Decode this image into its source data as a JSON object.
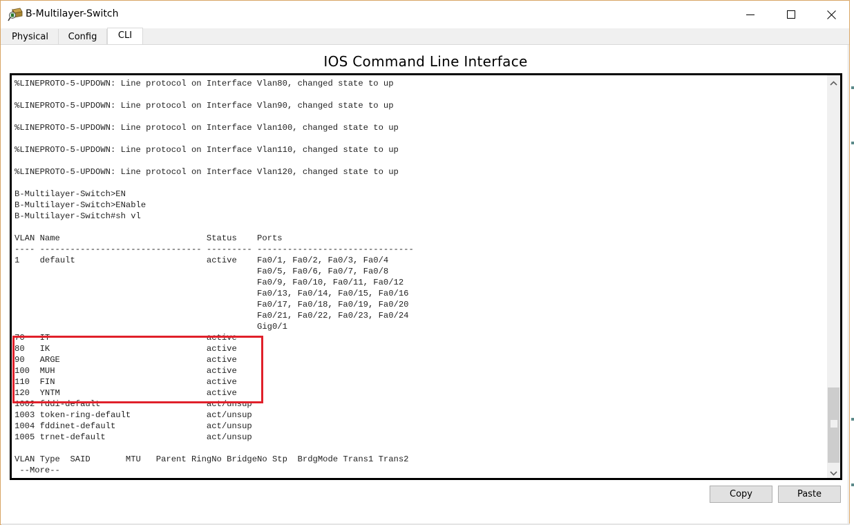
{
  "window": {
    "title": "B-Multilayer-Switch",
    "icon": "packet-tracer-device-icon",
    "controls": {
      "minimize": "minimize-icon",
      "maximize": "maximize-icon",
      "close": "close-icon"
    }
  },
  "tabs": [
    {
      "label": "Physical",
      "active": false
    },
    {
      "label": "Config",
      "active": false
    },
    {
      "label": "CLI",
      "active": true
    }
  ],
  "heading": "IOS Command Line Interface",
  "terminal": {
    "lines": [
      "%LINEPROTO-5-UPDOWN: Line protocol on Interface Vlan80, changed state to up",
      "",
      "%LINEPROTO-5-UPDOWN: Line protocol on Interface Vlan90, changed state to up",
      "",
      "%LINEPROTO-5-UPDOWN: Line protocol on Interface Vlan100, changed state to up",
      "",
      "%LINEPROTO-5-UPDOWN: Line protocol on Interface Vlan110, changed state to up",
      "",
      "%LINEPROTO-5-UPDOWN: Line protocol on Interface Vlan120, changed state to up",
      "",
      "B-Multilayer-Switch>EN",
      "B-Multilayer-Switch>ENable",
      "B-Multilayer-Switch#sh vl",
      "",
      "VLAN Name                             Status    Ports",
      "---- -------------------------------- --------- -------------------------------",
      "1    default                          active    Fa0/1, Fa0/2, Fa0/3, Fa0/4",
      "                                                Fa0/5, Fa0/6, Fa0/7, Fa0/8",
      "                                                Fa0/9, Fa0/10, Fa0/11, Fa0/12",
      "                                                Fa0/13, Fa0/14, Fa0/15, Fa0/16",
      "                                                Fa0/17, Fa0/18, Fa0/19, Fa0/20",
      "                                                Fa0/21, Fa0/22, Fa0/23, Fa0/24",
      "                                                Gig0/1",
      "70   IT                               active    ",
      "80   IK                               active    ",
      "90   ARGE                             active    ",
      "100  MUH                              active    ",
      "110  FIN                              active    ",
      "120  YNTM                             active    ",
      "1002 fddi-default                     act/unsup ",
      "1003 token-ring-default               act/unsup ",
      "1004 fddinet-default                  act/unsup ",
      "1005 trnet-default                    act/unsup ",
      "",
      "VLAN Type  SAID       MTU   Parent RingNo BridgeNo Stp  BrdgMode Trans1 Trans2",
      " --More--"
    ],
    "vlan_table": {
      "headers": [
        "VLAN",
        "Name",
        "Status",
        "Ports"
      ],
      "rows": [
        {
          "vlan": "1",
          "name": "default",
          "status": "active",
          "ports": "Fa0/1, Fa0/2, Fa0/3, Fa0/4, Fa0/5, Fa0/6, Fa0/7, Fa0/8, Fa0/9, Fa0/10, Fa0/11, Fa0/12, Fa0/13, Fa0/14, Fa0/15, Fa0/16, Fa0/17, Fa0/18, Fa0/19, Fa0/20, Fa0/21, Fa0/22, Fa0/23, Fa0/24, Gig0/1"
        },
        {
          "vlan": "70",
          "name": "IT",
          "status": "active",
          "ports": ""
        },
        {
          "vlan": "80",
          "name": "IK",
          "status": "active",
          "ports": ""
        },
        {
          "vlan": "90",
          "name": "ARGE",
          "status": "active",
          "ports": ""
        },
        {
          "vlan": "100",
          "name": "MUH",
          "status": "active",
          "ports": ""
        },
        {
          "vlan": "110",
          "name": "FIN",
          "status": "active",
          "ports": ""
        },
        {
          "vlan": "120",
          "name": "YNTM",
          "status": "active",
          "ports": ""
        },
        {
          "vlan": "1002",
          "name": "fddi-default",
          "status": "act/unsup",
          "ports": ""
        },
        {
          "vlan": "1003",
          "name": "token-ring-default",
          "status": "act/unsup",
          "ports": ""
        },
        {
          "vlan": "1004",
          "name": "fddinet-default",
          "status": "act/unsup",
          "ports": ""
        },
        {
          "vlan": "1005",
          "name": "trnet-default",
          "status": "act/unsup",
          "ports": ""
        }
      ],
      "highlighted_vlans": [
        "70",
        "80",
        "90",
        "100",
        "110",
        "120"
      ]
    },
    "highlight_color": "#e0202a",
    "scroll_position": 0.95
  },
  "buttons": {
    "copy": "Copy",
    "paste": "Paste"
  }
}
